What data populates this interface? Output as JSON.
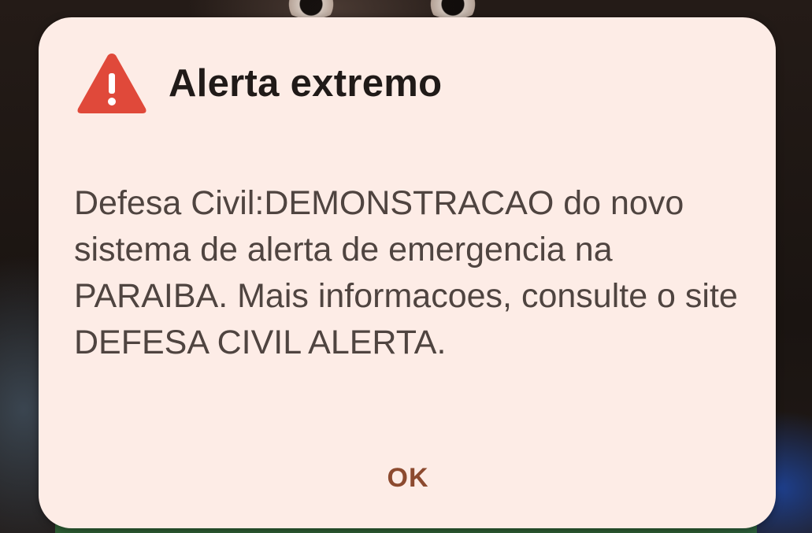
{
  "dialog": {
    "title": "Alerta extremo",
    "icon": "warning-triangle-icon",
    "icon_color": "#e0493a",
    "message": "Defesa Civil:DEMONSTRACAO do novo sistema de alerta de emergencia na PARAIBA. Mais informacoes, consulte o site DEFESA CIVIL ALERTA.",
    "ok_label": "OK",
    "background_color": "#fdece6",
    "accent_color": "#8c4a2f"
  }
}
